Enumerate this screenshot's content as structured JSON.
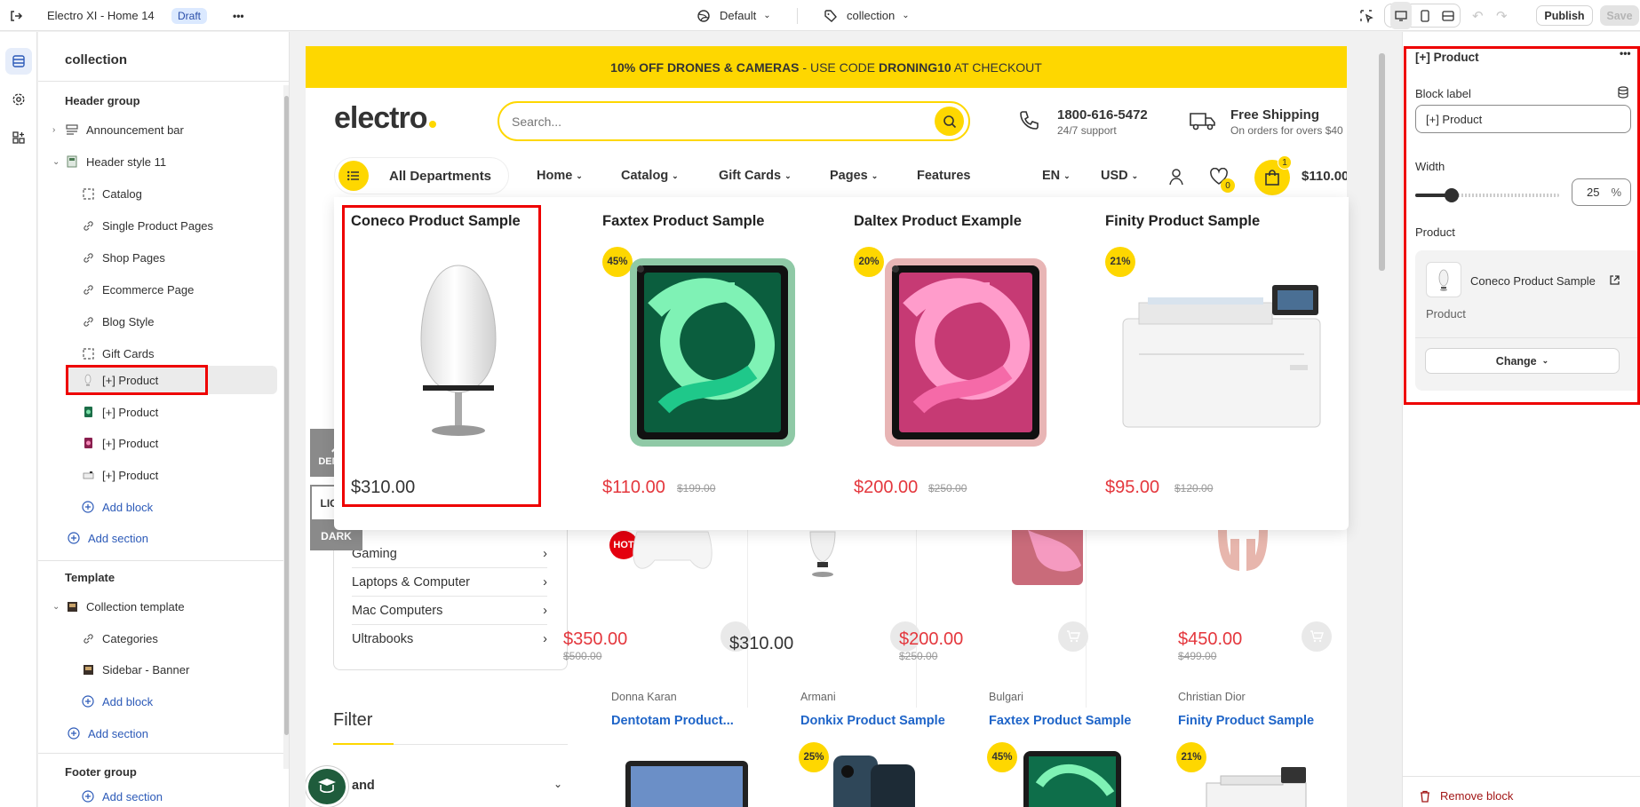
{
  "topbar": {
    "theme_name": "Electro XI - Home 14",
    "status_badge": "Draft",
    "more": "•••",
    "template_select": "Default",
    "page_select": "collection",
    "publish_label": "Publish",
    "save_label": "Save"
  },
  "tree": {
    "title": "collection",
    "header_group": "Header group",
    "items": [
      {
        "label": "Announcement bar",
        "icon": "announcement-icon"
      },
      {
        "label": "Header style 11",
        "icon": "header-thumb-icon"
      },
      {
        "label": "Catalog",
        "icon": "dashed-square-icon"
      },
      {
        "label": "Single Product Pages",
        "icon": "link-icon"
      },
      {
        "label": "Shop Pages",
        "icon": "link-icon"
      },
      {
        "label": "Ecommerce Page",
        "icon": "link-icon"
      },
      {
        "label": "Blog Style",
        "icon": "link-icon"
      },
      {
        "label": "Gift Cards",
        "icon": "dashed-square-icon"
      },
      {
        "label": "[+] Product",
        "icon": "product-thumb-icon"
      },
      {
        "label": "[+] Product",
        "icon": "product-thumb-icon"
      },
      {
        "label": "[+] Product",
        "icon": "product-thumb-icon"
      },
      {
        "label": "[+] Product",
        "icon": "product-thumb-icon"
      }
    ],
    "add_block": "Add block",
    "add_section": "Add section",
    "template_head": "Template",
    "template_items": [
      {
        "label": "Collection template",
        "icon": "template-thumb-icon"
      },
      {
        "label": "Categories",
        "icon": "link-icon"
      },
      {
        "label": "Sidebar - Banner",
        "icon": "template-thumb-icon"
      }
    ],
    "add_block2": "Add block",
    "add_section2": "Add section",
    "footer_head": "Footer group",
    "footer_partial": "Add section"
  },
  "store": {
    "announcement_bold": "10% OFF DRONES & CAMERAS",
    "announcement_mid": " - USE CODE ",
    "announcement_code": "DRONING10",
    "announcement_end": " AT CHECKOUT",
    "logo": "electro",
    "search_placeholder": "Search...",
    "phone": "1800-616-5472",
    "phone_sub": "24/7 support",
    "shipping": "Free Shipping",
    "shipping_sub": "On orders for overs $40",
    "departments": "All Departments",
    "nav": [
      "Home",
      "Catalog",
      "Gift Cards",
      "Pages",
      "Features"
    ],
    "lang": "EN",
    "currency": "USD",
    "wishlist_count": "0",
    "cart_count": "1",
    "cart_total": "$110.00",
    "demos": "DEMOS",
    "light": "LIGHT",
    "dark": "DARK",
    "categories": [
      "Gaming",
      "Laptops & Computer",
      "Mac Computers",
      "Ultrabooks"
    ],
    "filter": "Filter",
    "brand_filter": "and",
    "hot": "HOT",
    "grid_prices": [
      {
        "price": "$350.00",
        "old": "$500.00"
      },
      {
        "price": "$310.00",
        "old": ""
      },
      {
        "price": "$200.00",
        "old": "$250.00"
      },
      {
        "price": "$450.00",
        "old": "$499.00"
      }
    ],
    "bottom_products": [
      {
        "brand": "Donna Karan",
        "title": "Dentotam Product...",
        "disc": ""
      },
      {
        "brand": "Armani",
        "title": "Donkix Product Sample",
        "disc": "25%"
      },
      {
        "brand": "Bulgari",
        "title": "Faxtex Product Sample",
        "disc": "45%"
      },
      {
        "brand": "Christian Dior",
        "title": "Finity Product Sample",
        "disc": "21%"
      }
    ]
  },
  "mega": [
    {
      "title": "Coneco Product Sample",
      "price": "$310.00",
      "old": "",
      "disc": ""
    },
    {
      "title": "Faxtex Product Sample",
      "price": "$110.00",
      "old": "$199.00",
      "disc": "45%"
    },
    {
      "title": "Daltex Product Example",
      "price": "$200.00",
      "old": "$250.00",
      "disc": "20%"
    },
    {
      "title": "Finity Product Sample",
      "price": "$95.00",
      "old": "$120.00",
      "disc": "21%"
    }
  ],
  "settings": {
    "title": "[+] Product",
    "block_label": "Block label",
    "block_label_value": "[+] Product",
    "width_label": "Width",
    "width_value": "25",
    "width_percent": 25,
    "width_unit": "%",
    "product_label": "Product",
    "product_name": "Coneco Product Sample",
    "product_sub": "Product",
    "change": "Change",
    "remove": "Remove block"
  },
  "colors": {
    "brand_yellow": "#fed700",
    "price_red": "#e4373d",
    "link_blue": "#2c5ab8",
    "highlight_red": "#e00000"
  }
}
